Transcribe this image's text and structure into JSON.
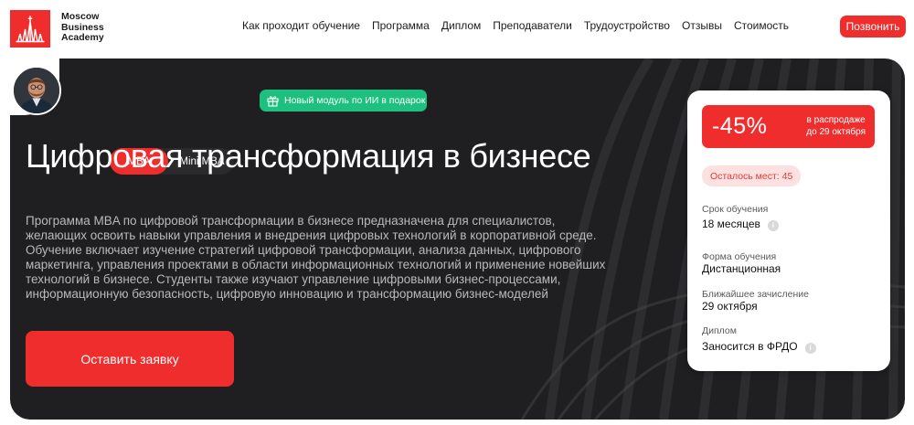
{
  "brand": {
    "lines": [
      "Moscow",
      "Business",
      "Academy"
    ],
    "accent_color": "#f02d2d"
  },
  "nav": {
    "items": [
      {
        "label": "Как проходит обучение"
      },
      {
        "label": "Программа"
      },
      {
        "label": "Диплом"
      },
      {
        "label": "Преподаватели"
      },
      {
        "label": "Трудоустройство"
      },
      {
        "label": "Отзывы"
      },
      {
        "label": "Стоимость"
      }
    ],
    "call_label": "Позвонить"
  },
  "hero": {
    "tabs": [
      {
        "label": "MBA",
        "active": true
      },
      {
        "label": "Mini MBA",
        "active": false
      }
    ],
    "promo": {
      "label": "Новый модуль по ИИ в подарок",
      "icon": "gift-icon",
      "color": "#1ec07f"
    },
    "title": "Цифровая трансформация в бизнесе",
    "description": "Программа MBA по цифровой трансформации в бизнесе предназначена для специалистов, желающих освоить навыки управления и внедрения цифровых технологий в корпоративной среде. Обучение включает изучение стратегий цифровой трансформации, анализа данных, цифрового маркетинга, управления проектами в области информационных технологий и применение новейших технологий в бизнесе. Студенты также изучают управление цифровыми бизнес-процессами, информационную безопасность, цифровую инновацию и трансформацию бизнес-моделей",
    "apply_label": "Оставить заявку",
    "background_color": "#1f1f21"
  },
  "card": {
    "discount": {
      "value": "-45%",
      "line1": "в распродаже",
      "line2": "до 29 октября"
    },
    "seats_label": "Осталось мест: 45",
    "items": [
      {
        "label": "Срок обучения",
        "value": "18 месяцев",
        "has_info": true
      },
      {
        "label": "Форма обучения",
        "value": "Дистанционная",
        "has_info": false
      },
      {
        "label": "Ближайшее зачисление",
        "value": "29 октября",
        "has_info": false
      },
      {
        "label": "Диплом",
        "value": "Заносится в ФРДО",
        "has_info": true
      }
    ],
    "info_icon_glyph": "i"
  }
}
